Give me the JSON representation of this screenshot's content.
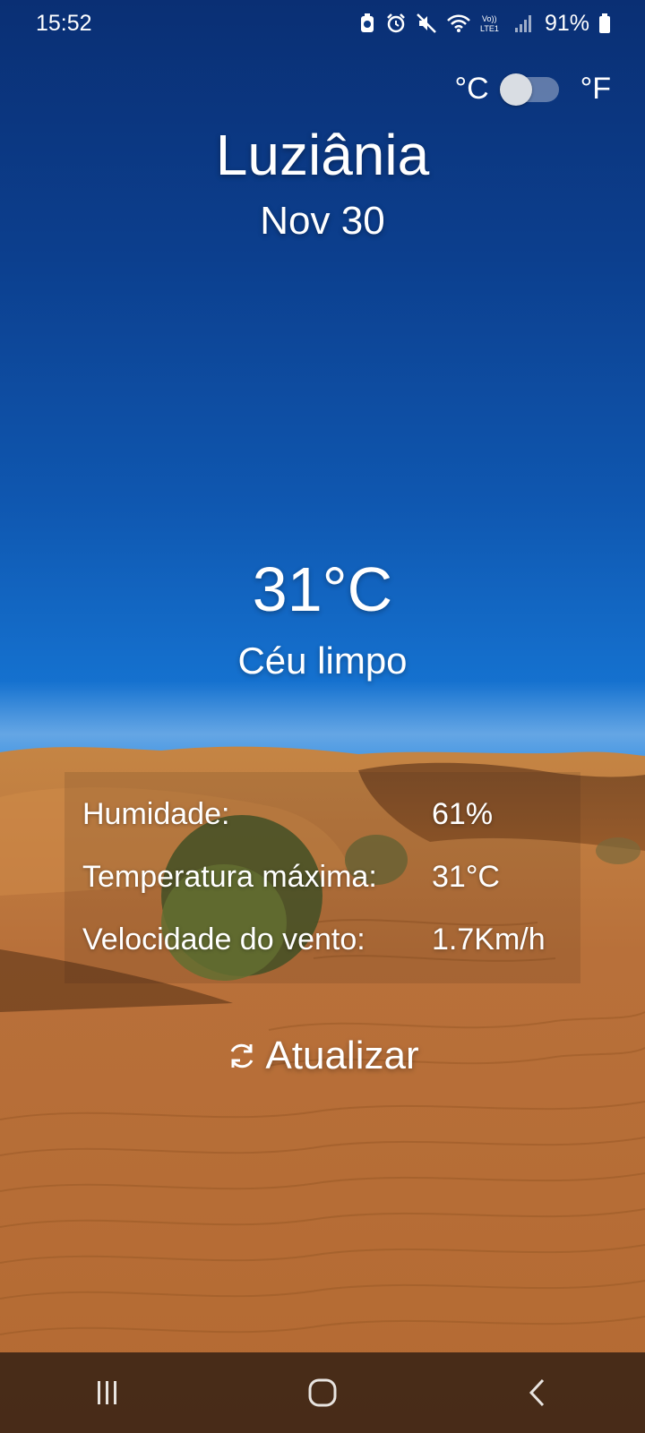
{
  "status_bar": {
    "time": "15:52",
    "battery": "91%",
    "icons": [
      "data-saver-icon",
      "alarm-icon",
      "mute-icon",
      "wifi-icon",
      "volte-lte-icon",
      "signal-icon",
      "battery-icon"
    ]
  },
  "unit_toggle": {
    "celsius_label": "°C",
    "fahrenheit_label": "°F",
    "selected": "°C"
  },
  "location": {
    "city": "Luziânia",
    "date": "Nov 30"
  },
  "current": {
    "temperature": "31°C",
    "condition": "Céu limpo"
  },
  "details": [
    {
      "label": "Humidade:",
      "value": "61%"
    },
    {
      "label": "Temperatura máxima:",
      "value": "31°C"
    },
    {
      "label": "Velocidade do vento:",
      "value": "1.7Km/h"
    }
  ],
  "refresh_button": {
    "label": "Atualizar",
    "icon": "refresh-icon"
  },
  "nav_bar": {
    "icons": [
      "recent-apps-icon",
      "home-icon",
      "back-icon"
    ]
  },
  "colors": {
    "sky_top": "#0a2f74",
    "sky_mid": "#1572d0",
    "sand": "#c07a3c",
    "text": "#ffffff"
  }
}
